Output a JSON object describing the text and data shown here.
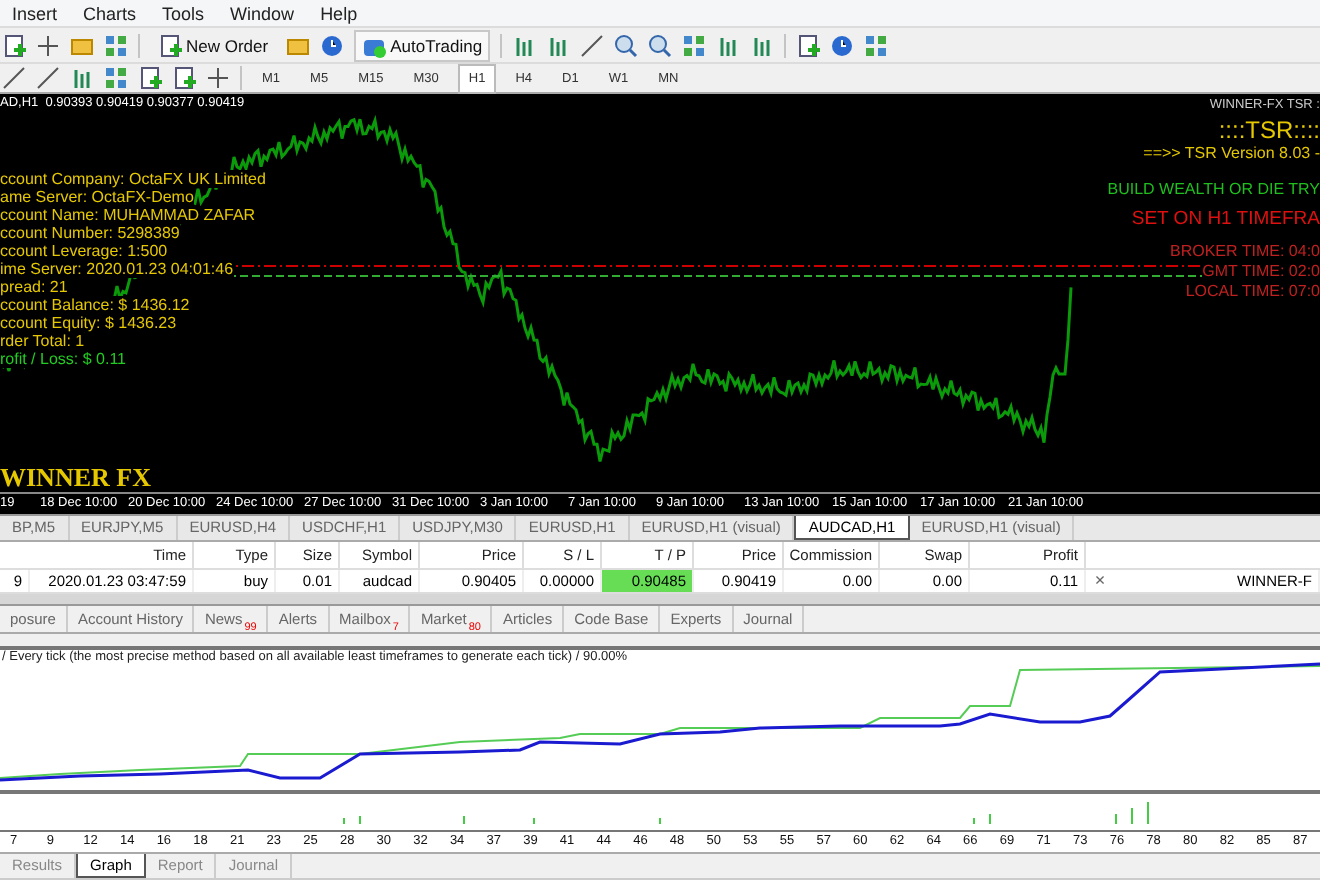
{
  "menu": [
    "Insert",
    "Charts",
    "Tools",
    "Window",
    "Help"
  ],
  "toolbar": {
    "new_order": "New Order",
    "auto_trading": "AutoTrading"
  },
  "timeframes": [
    {
      "label": "M1",
      "selected": false
    },
    {
      "label": "M5",
      "selected": false
    },
    {
      "label": "M15",
      "selected": false
    },
    {
      "label": "M30",
      "selected": false
    },
    {
      "label": "H1",
      "selected": true
    },
    {
      "label": "H4",
      "selected": false
    },
    {
      "label": "D1",
      "selected": false
    },
    {
      "label": "W1",
      "selected": false
    },
    {
      "label": "MN",
      "selected": false
    }
  ],
  "chart": {
    "header": "AD,H1  0.90393 0.90419 0.90377 0.90419",
    "account_info": [
      {
        "text": "ccount Company: OctaFX UK Limited",
        "color": "#e6c800"
      },
      {
        "text": "ame Server: OctaFX-Demo",
        "color": "#e6c800"
      },
      {
        "text": "ccount Name: MUHAMMAD ZAFAR",
        "color": "#e6c800"
      },
      {
        "text": "ccount Number: 5298389",
        "color": "#e6c800"
      },
      {
        "text": "ccount Leverage: 1:500",
        "color": "#e6c800"
      },
      {
        "text": "ime Server: 2020.01.23 04:01:46",
        "color": "#e6c800"
      },
      {
        "text": "pread: 21",
        "color": "#e6c800"
      },
      {
        "text": "ccount Balance: $ 1436.12",
        "color": "#e6c800"
      },
      {
        "text": "ccount Equity: $ 1436.23",
        "color": "#e6c800"
      },
      {
        "text": "rder Total: 1",
        "color": "#e6c800"
      },
      {
        "text": "rofit / Loss: $ 0.11",
        "color": "#22cc22"
      }
    ],
    "logo": "WINNER FX",
    "indicator_title": "WINNER-FX TSR :",
    "tsr_title": "::::TSR::::",
    "version": "==>> TSR Version 8.03 -",
    "slogan": "BUILD WEALTH OR DIE TRY",
    "timeframe_note": "SET ON H1 TIMEFRA",
    "times": [
      "BROKER TIME: 04:0",
      "GMT TIME: 02:0",
      "LOCAL TIME: 07:0"
    ],
    "date_axis": [
      "19",
      "18 Dec 10:00",
      "20 Dec 10:00",
      "24 Dec 10:00",
      "27 Dec 10:00",
      "31 Dec 10:00",
      "3 Jan 10:00",
      "7 Jan 10:00",
      "9 Jan 10:00",
      "13 Jan 10:00",
      "15 Jan 10:00",
      "17 Jan 10:00",
      "21 Jan 10:00"
    ]
  },
  "chart_tabs": [
    {
      "label": "BP,M5",
      "selected": false
    },
    {
      "label": "EURJPY,M5",
      "selected": false
    },
    {
      "label": "EURUSD,H4",
      "selected": false
    },
    {
      "label": "USDCHF,H1",
      "selected": false
    },
    {
      "label": "USDJPY,M30",
      "selected": false
    },
    {
      "label": "EURUSD,H1",
      "selected": false
    },
    {
      "label": "EURUSD,H1 (visual)",
      "selected": false
    },
    {
      "label": "AUDCAD,H1",
      "selected": true
    },
    {
      "label": "EURUSD,H1 (visual)",
      "selected": false
    }
  ],
  "orders": {
    "columns": [
      "Time",
      "Type",
      "Size",
      "Symbol",
      "Price",
      "S / L",
      "T / P",
      "Price",
      "Commission",
      "Swap",
      "Profit"
    ],
    "rows": [
      {
        "ticket": "9",
        "cells": [
          "2020.01.23 03:47:59",
          "buy",
          "0.01",
          "audcad",
          "0.90405",
          "0.00000",
          "0.90485",
          "0.90419",
          "0.00",
          "0.00",
          "0.11"
        ],
        "close": "×",
        "comment": "WINNER-F"
      }
    ]
  },
  "terminal_tabs": [
    {
      "label": "posure"
    },
    {
      "label": "Account History"
    },
    {
      "label": "News",
      "badge": "99"
    },
    {
      "label": "Alerts"
    },
    {
      "label": "Mailbox",
      "badge": "7"
    },
    {
      "label": "Market",
      "badge": "80"
    },
    {
      "label": "Articles"
    },
    {
      "label": "Code Base"
    },
    {
      "label": "Experts"
    },
    {
      "label": "Journal"
    }
  ],
  "tester": {
    "description": "/ Every tick (the most precise method based on all available least timeframes to generate each tick) / 90.00%",
    "x_ticks": [
      "7",
      "9",
      "12",
      "14",
      "16",
      "18",
      "21",
      "23",
      "25",
      "28",
      "30",
      "32",
      "34",
      "37",
      "39",
      "41",
      "44",
      "46",
      "48",
      "50",
      "53",
      "55",
      "57",
      "60",
      "62",
      "64",
      "66",
      "69",
      "71",
      "73",
      "76",
      "78",
      "80",
      "82",
      "85",
      "87"
    ]
  },
  "tester_tabs": [
    {
      "label": "Results",
      "selected": false
    },
    {
      "label": "Graph",
      "selected": true
    },
    {
      "label": "Report",
      "selected": false
    },
    {
      "label": "Journal",
      "selected": false
    }
  ]
}
